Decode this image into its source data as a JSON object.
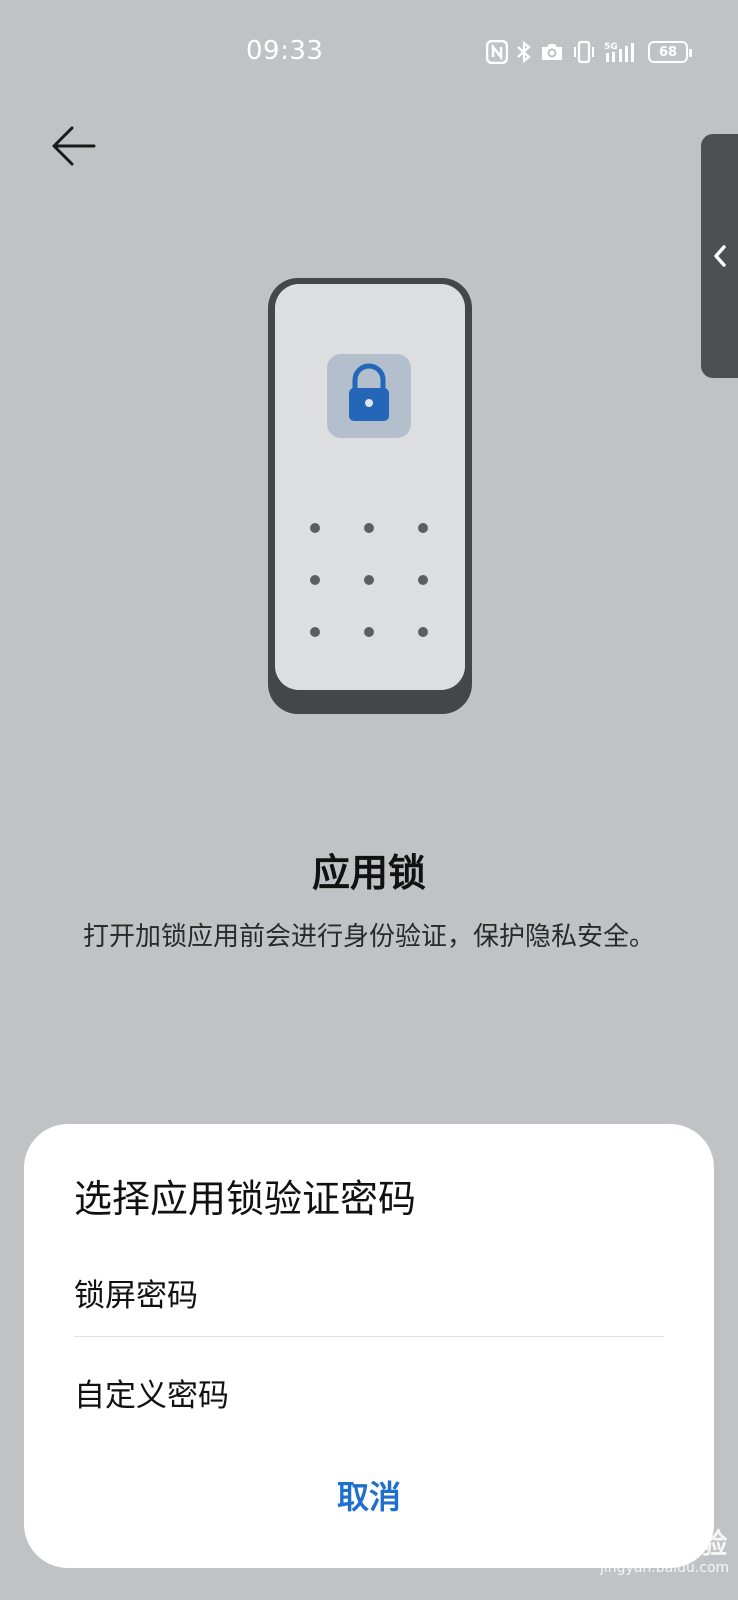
{
  "status_bar": {
    "time": "09:33",
    "battery": "68",
    "network": "5G",
    "icons": [
      "nfc-icon",
      "bluetooth-icon",
      "camera-icon",
      "vibrate-icon",
      "signal-icon",
      "battery-icon"
    ]
  },
  "nav": {
    "back_icon": "arrow-left-icon"
  },
  "side_panel": {
    "icon": "chevron-left-icon"
  },
  "illustration": {
    "icon": "lock-icon",
    "dots": 9
  },
  "feature": {
    "title": "应用锁",
    "description": "打开加锁应用前会进行身份验证，保护隐私安全。"
  },
  "sheet": {
    "title": "选择应用锁验证密码",
    "options": [
      {
        "label": "锁屏密码"
      },
      {
        "label": "自定义密码"
      }
    ],
    "cancel_label": "取消"
  },
  "watermark": {
    "brand": "Bai du 经验",
    "url": "jingyan.baidu.com"
  },
  "colors": {
    "background": "#c1c2c5",
    "accent": "#1f6fcf",
    "sheet": "#ffffff",
    "lock_icon": "#2466b8"
  }
}
